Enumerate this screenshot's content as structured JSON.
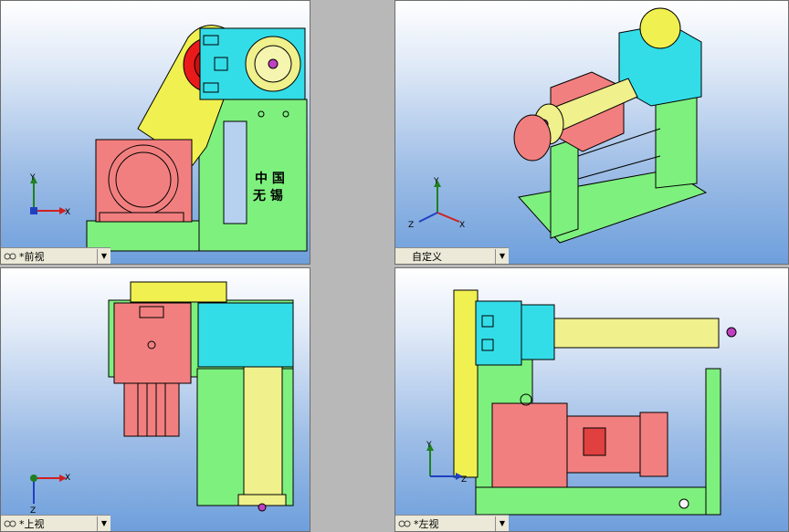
{
  "views": [
    {
      "id": "front",
      "label": "*前视"
    },
    {
      "id": "custom",
      "label": "自定义"
    },
    {
      "id": "top",
      "label": "*上视"
    },
    {
      "id": "left",
      "label": "*左视"
    }
  ],
  "labels": {
    "brand_line1": "中  国",
    "brand_line2": "无  锡"
  },
  "axes": {
    "x": "X",
    "y": "Y",
    "z": "Z"
  },
  "colors": {
    "frame": "#7ef07e",
    "motor": "#f27f7f",
    "gearbox": "#33dde8",
    "barrel": "#f0f08c",
    "pulley": "#ea1a1a",
    "belt": "#f0f050"
  }
}
